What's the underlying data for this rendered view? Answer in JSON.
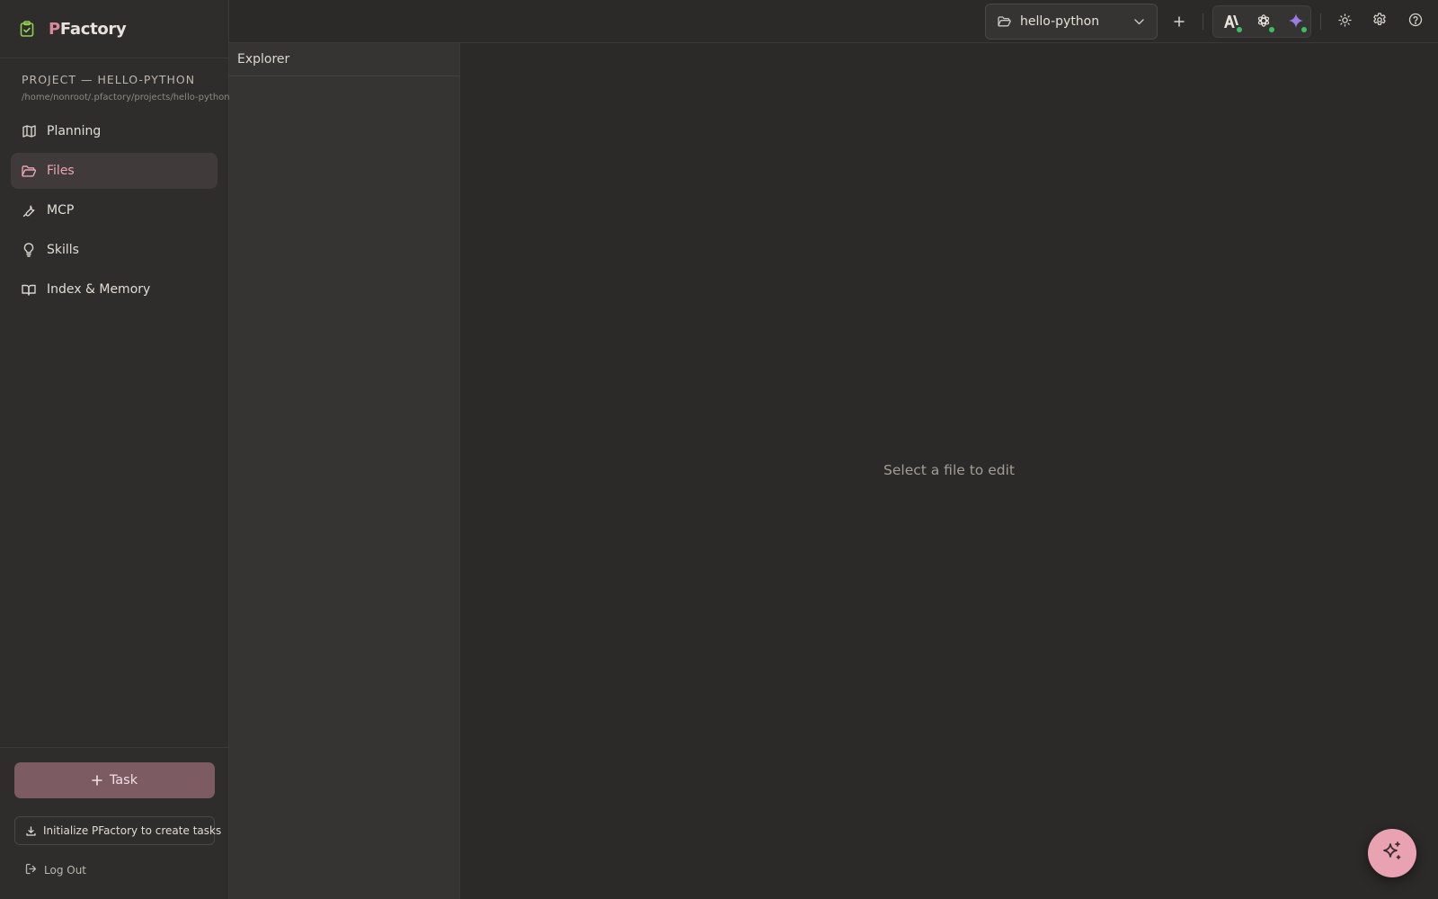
{
  "app": {
    "logo_accent": "P",
    "logo_rest": "Factory"
  },
  "sidebar": {
    "project_label": "PROJECT — HELLO-PYTHON",
    "project_path": "/home/nonroot/.pfactory/projects/hello-python",
    "items": [
      {
        "label": "Planning",
        "icon": "map-icon"
      },
      {
        "label": "Files",
        "icon": "folder-open-icon",
        "active": true
      },
      {
        "label": "MCP",
        "icon": "wrench-icon"
      },
      {
        "label": "Skills",
        "icon": "lightbulb-icon"
      },
      {
        "label": "Index & Memory",
        "icon": "book-open-icon"
      }
    ],
    "task_button": "Task",
    "init_button": "Initialize PFactory to create tasks",
    "logout": "Log Out"
  },
  "topbar": {
    "project_select_value": "hello-python",
    "providers": [
      {
        "name": "anthropic-icon",
        "status": "connected"
      },
      {
        "name": "openai-icon",
        "status": "connected"
      },
      {
        "name": "gemini-icon",
        "status": "connected"
      }
    ]
  },
  "explorer": {
    "title": "Explorer"
  },
  "editor": {
    "empty_message": "Select a file to edit"
  },
  "colors": {
    "accent_pink": "#e8a2b2",
    "status_green": "#3ac062",
    "logo_green": "#7fc64b"
  }
}
